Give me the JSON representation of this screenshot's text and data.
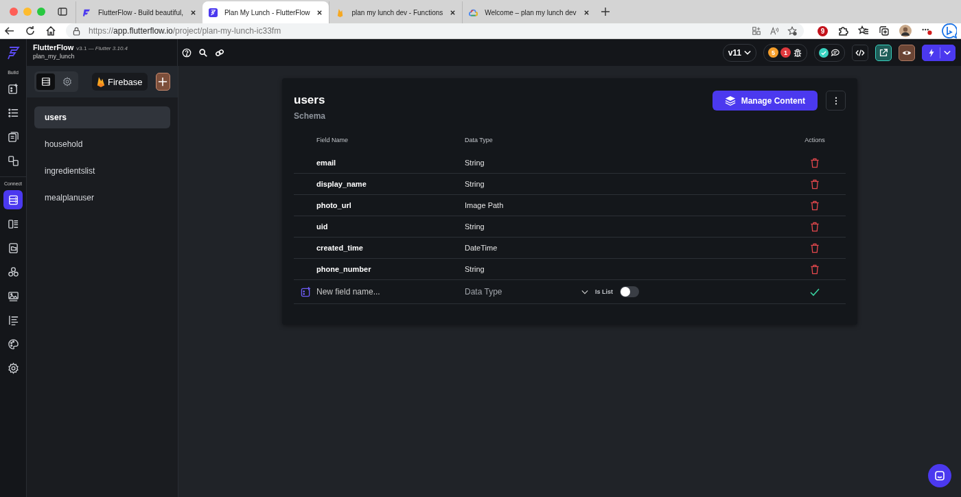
{
  "browser": {
    "tabs": [
      {
        "title": "FlutterFlow - Build beautiful,",
        "kind": "f-logo",
        "selected": false
      },
      {
        "title": "Plan My Lunch - FlutterFlow",
        "kind": "square-logo",
        "selected": true
      },
      {
        "title": "plan my lunch dev - Functions",
        "kind": "flame",
        "selected": false
      },
      {
        "title": "Welcome – plan my lunch dev",
        "kind": "cloud",
        "selected": false
      }
    ],
    "url": "https://**app.flutterflow.io**/project/plan-my-lunch-ic33fm",
    "extension_badge": "9"
  },
  "app": {
    "name": "FlutterFlow",
    "version": "v3.1 — *Flutter 3.10.4*",
    "project": "plan_my_lunch"
  },
  "toolbar": {
    "branch": "v11",
    "warnings": "5",
    "errors": "1"
  },
  "rail": [
    {
      "label": "Build",
      "items": [
        {
          "kind": "add-widget",
          "selected": false
        },
        {
          "kind": "list",
          "selected": false
        },
        {
          "kind": "pages",
          "selected": false
        },
        {
          "kind": "swap",
          "selected": false
        }
      ]
    },
    {
      "label": "Connect",
      "items": [
        {
          "kind": "database",
          "selected": true
        },
        {
          "kind": "table",
          "selected": false
        },
        {
          "kind": "folder",
          "selected": false
        },
        {
          "kind": "nodes",
          "selected": false
        },
        {
          "kind": "image",
          "selected": false
        },
        {
          "kind": "text",
          "selected": false
        },
        {
          "kind": "palette",
          "selected": false
        },
        {
          "kind": "settings",
          "selected": false
        }
      ]
    }
  ],
  "sidebar": {
    "views": [
      {
        "kind": "schema",
        "selected": true
      },
      {
        "kind": "settings",
        "selected": false
      }
    ],
    "source": "Firebase",
    "collections": [
      {
        "name": "users",
        "selected": true
      },
      {
        "name": "household",
        "selected": false
      },
      {
        "name": "ingredientslist",
        "selected": false
      },
      {
        "name": "mealplanuser",
        "selected": false
      }
    ]
  },
  "collection": {
    "title": "users",
    "subtitle": "Schema",
    "primary_button": "Manage Content",
    "columns": [
      "Field Name",
      "Data Type",
      "Actions"
    ],
    "rows": [
      {
        "field": "email",
        "type": "String"
      },
      {
        "field": "display_name",
        "type": "String"
      },
      {
        "field": "photo_url",
        "type": "Image Path"
      },
      {
        "field": "uid",
        "type": "String"
      },
      {
        "field": "created_time",
        "type": "DateTime"
      },
      {
        "field": "phone_number",
        "type": "String"
      }
    ],
    "new_field": {
      "placeholder": "New field name...",
      "type_placeholder": "Data Type",
      "list_toggle": {
        "label": "Is List",
        "on": false
      }
    }
  }
}
